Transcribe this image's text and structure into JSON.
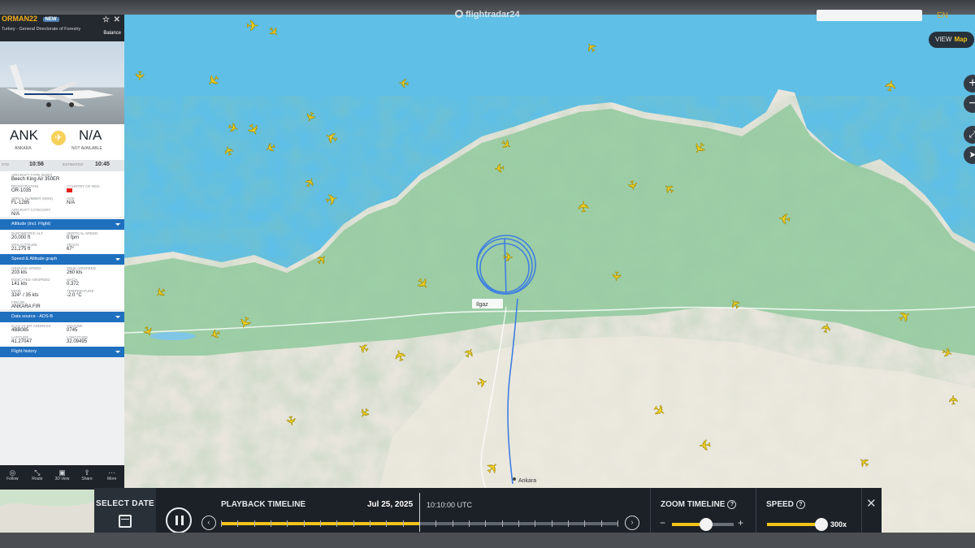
{
  "header": {
    "logo_text": "flightradar24",
    "search_placeholder": "",
    "top_right_label": "EN"
  },
  "panel": {
    "callsign": "ORMAN22",
    "badge": "NEW",
    "operator": "Turkey - General Directorate of Forestry",
    "balance_label": "Balance",
    "photo_credit": "",
    "origin_code": "ANK",
    "origin_name": "ANKARA",
    "destination_code": "N/A",
    "destination_name": "NOT AVAILABLE",
    "std_label": "STD",
    "departure_time": "10:56",
    "estimated_label": "ESTIMATED",
    "arrival_time": "10:45",
    "aircraft_type_label": "AIRCRAFT TYPE (B350)",
    "aircraft_type": "Beech King Air 350ER",
    "registration_label": "REGISTRATION",
    "registration": "OR-1035",
    "country_label": "COUNTRY OF REG.",
    "serial_label": "SERIAL NUMBER (MSN)",
    "serial": "FL-1285",
    "age_label": "AGE",
    "age": "N/A",
    "category_label": "AIRCRAFT CATEGORY",
    "category": "N/A",
    "sec_altitude": "Altitude (incl. Flight)",
    "baro_alt_label": "BAROMETRIC ALT.",
    "baro_alt": "20,000 ft",
    "vs_label": "VERTICAL SPEED",
    "vs": "0 fpm",
    "gps_alt_label": "GPS ALTITUDE",
    "gps_alt": "21,275 ft",
    "track_label": "TRACK",
    "track": "67°",
    "sec_speed": "Speed & Altitude graph",
    "gs_label": "GROUND SPEED",
    "gs": "203 kts",
    "tas_label": "TRUE AIRSPEED",
    "tas": "260 kts",
    "ias_label": "INDICATED AIRSPEED",
    "ias": "141 kts",
    "mach_label": "MACH",
    "mach": "0.372",
    "wind_label": "WIND",
    "wind": "324° / 35 kts",
    "temp_label": "TEMPERATURE",
    "temp": "-2.0 °C",
    "fir_label": "FIR/UIR",
    "fir": "ANKARA FIR",
    "sec_source": "Data source - ADS-B",
    "icao_label": "ICAO 24-BIT ADDRESS",
    "icao": "4BB085",
    "squawk_label": "SQUAWK",
    "squawk": "0745",
    "lat_label": "LATITUDE",
    "lat": "41.27047",
    "lon_label": "LONGITUDE",
    "lon": "32.09495",
    "sec_history": "Flight history",
    "tabs": [
      "Follow",
      "Route",
      "3D view",
      "Share",
      "More"
    ]
  },
  "playback": {
    "select_date": "SELECT DATE",
    "title": "PLAYBACK TIMELINE",
    "date": "Jul 25, 2025",
    "time": "10:10:00 UTC",
    "progress": 0.5,
    "zoom_title": "ZOOM TIMELINE",
    "zoom_level": 0.55,
    "speed_title": "SPEED",
    "speed_level": 0.95,
    "speed_value": "300x",
    "help_glyph": "?"
  },
  "map": {
    "view_label": "VIEW",
    "view_value": "Map",
    "city_label": "Ilgaz",
    "city_south": "Ankara"
  },
  "colors": {
    "sea": "#5fbfe6",
    "land": "#e7e5dc",
    "forest": "#8fca9c",
    "aircraft": "#f2d020",
    "accent": "#f2c31b",
    "track": "#3f7fe0"
  }
}
